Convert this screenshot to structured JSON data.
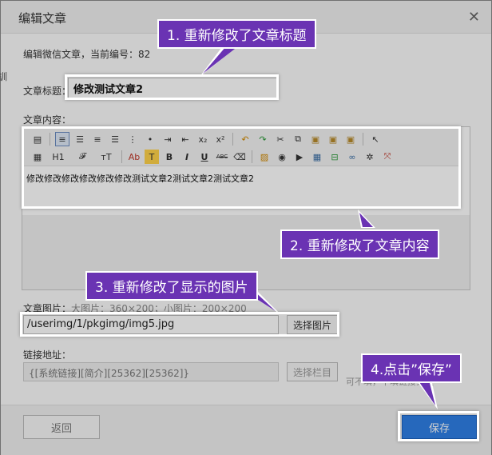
{
  "dialog": {
    "title": "编辑文章",
    "close_icon": "close-icon",
    "left_peek": "訓",
    "info": "编辑微信文章，当前编号：82"
  },
  "form": {
    "title_label": "文章标题：",
    "title_value": "修改测试文章2",
    "content_label": "文章内容：",
    "content_value": "修改修改修改修改修改修改测试文章2测试文章2测试文章2",
    "image_label": "文章图片：",
    "image_hint": "大图片：360×200；小图片：200×200",
    "image_value": "/userimg/1/pkgimg/img5.jpg",
    "image_button": "选择图片",
    "link_label": "链接地址：",
    "link_value": "{[系统链接][简介][25362][25362]}",
    "link_button": "选择栏目",
    "link_hint": "可不填，不填链接到文"
  },
  "toolbar": {
    "row1": [
      "source-icon",
      "align-left-icon",
      "align-center-icon",
      "align-right-icon",
      "align-justify-icon",
      "ordered-list-icon",
      "unordered-list-icon",
      "indent-icon",
      "outdent-icon",
      "subscript-icon",
      "superscript-icon",
      "undo-icon",
      "redo-icon",
      "cut-icon",
      "copy-icon",
      "paste-icon",
      "paste-text-icon",
      "paste-word-icon",
      "select-all-icon"
    ],
    "row2": [
      "template-icon",
      "heading-icon",
      "font-family-icon",
      "font-size-icon",
      "font-color-icon",
      "highlight-icon",
      "bold-icon",
      "italic-icon",
      "underline-icon",
      "strikethrough-icon",
      "eraser-icon",
      "image-icon",
      "flash-icon",
      "media-icon",
      "table-icon",
      "hr-icon",
      "link-icon",
      "unlink-icon",
      "fullscreen-icon"
    ],
    "h1": "H1",
    "sub": "x₂",
    "sup": "x²",
    "b": "B",
    "i": "I",
    "u": "U",
    "abc": "ABC",
    "ab": "Ab",
    "t": "T",
    "font_family": "𝓕",
    "font_size": "тT"
  },
  "footer": {
    "back_label": "返回",
    "save_label": "保存"
  },
  "callouts": {
    "c1": "1. 重新修改了文章标题",
    "c2": "2. 重新修改了文章内容",
    "c3": "3. 重新修改了显示的图片",
    "c4": "4.点击”保存”"
  },
  "colors": {
    "callout_bg": "#6a33b3",
    "save_bg": "#2f7fe6"
  }
}
